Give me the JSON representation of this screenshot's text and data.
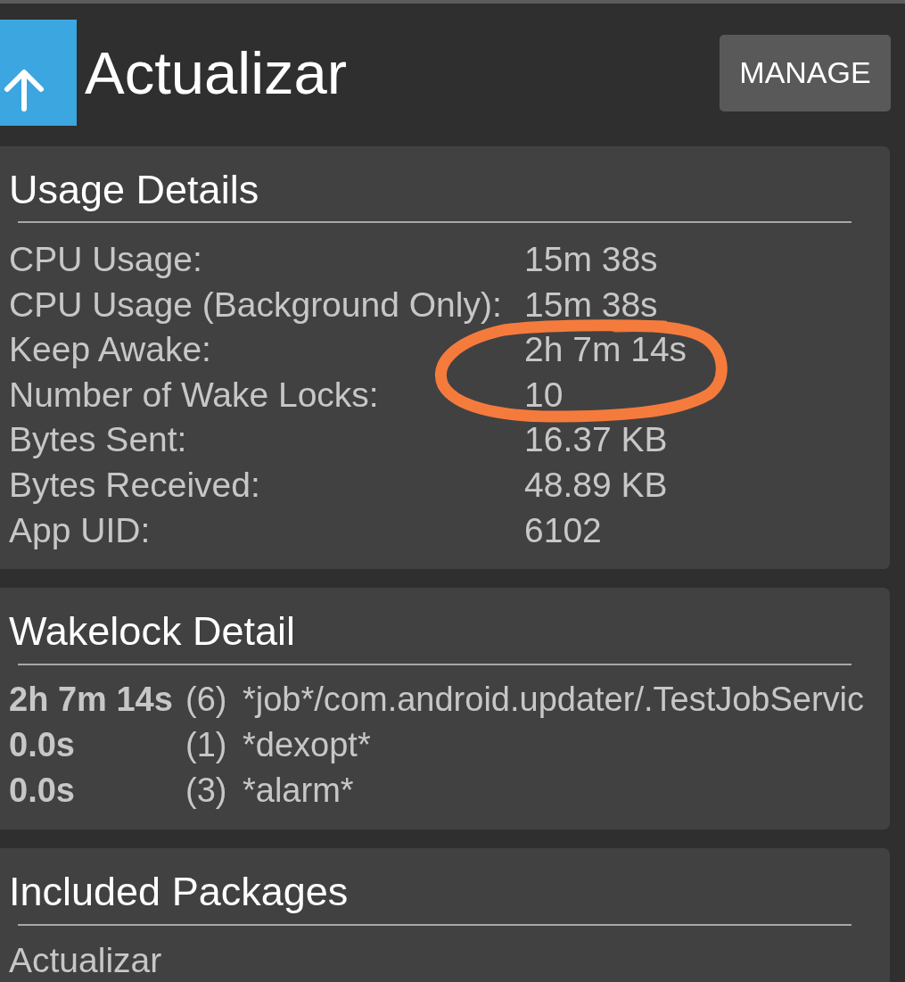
{
  "header": {
    "title": "Actualizar",
    "button": "MANAGE"
  },
  "usage_details": {
    "title": "Usage Details",
    "rows": [
      {
        "label": "CPU Usage:",
        "value": "15m 38s"
      },
      {
        "label": "CPU Usage (Background Only):",
        "value": "15m 38s"
      },
      {
        "label": "Keep Awake:",
        "value": "2h 7m 14s"
      },
      {
        "label": "Number of Wake Locks:",
        "value": "10"
      },
      {
        "label": "Bytes Sent:",
        "value": "16.37 KB"
      },
      {
        "label": "Bytes Received:",
        "value": "48.89 KB"
      },
      {
        "label": "App UID:",
        "value": "6102"
      }
    ]
  },
  "wakelock_detail": {
    "title": "Wakelock Detail",
    "rows": [
      {
        "time": "2h 7m 14s",
        "count": "(6)",
        "name": "*job*/com.android.updater/.TestJobServic"
      },
      {
        "time": "0.0s",
        "count": "(1)",
        "name": "*dexopt*"
      },
      {
        "time": "0.0s",
        "count": "(3)",
        "name": "*alarm*"
      }
    ]
  },
  "included_packages": {
    "title": "Included Packages",
    "items": [
      "Actualizar"
    ]
  }
}
